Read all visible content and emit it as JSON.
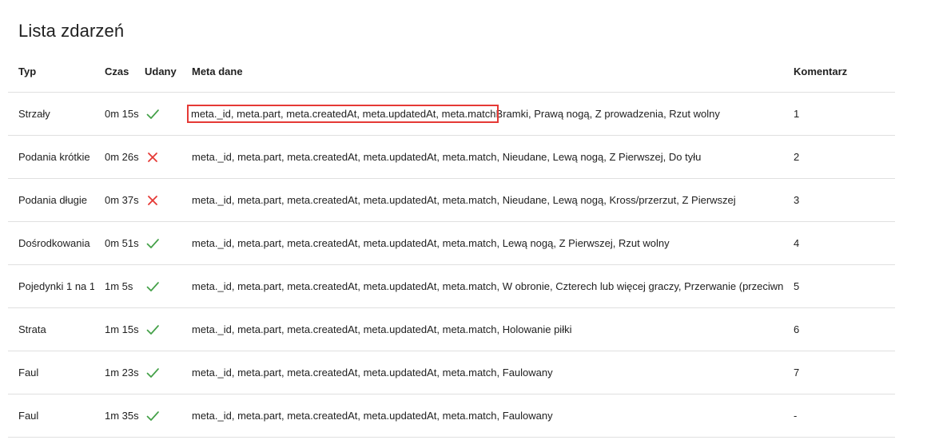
{
  "page": {
    "title": "Lista zdarzeń"
  },
  "table": {
    "headers": {
      "typ": "Typ",
      "czas": "Czas",
      "udany": "Udany",
      "meta": "Meta dane",
      "komentarz": "Komentarz"
    },
    "meta_prefix": "meta._id, meta.part, meta.createdAt, meta.updatedAt, meta.match",
    "rows": [
      {
        "typ": "Strzały",
        "czas": "0m 15s",
        "udany": "check-icon",
        "meta_suffix": "Bramki, Prawą nogą, Z prowadzenia, Rzut wolny",
        "komentarz": "1"
      },
      {
        "typ": "Podania krótkie",
        "czas": "0m 26s",
        "udany": "cross-icon",
        "meta_suffix": ", Nieudane, Lewą nogą, Z Pierwszej, Do tyłu",
        "komentarz": "2"
      },
      {
        "typ": "Podania długie",
        "czas": "0m 37s",
        "udany": "cross-icon",
        "meta_suffix": ", Nieudane, Lewą nogą, Kross/przerzut, Z Pierwszej",
        "komentarz": "3"
      },
      {
        "typ": "Dośrodkowania",
        "czas": "0m 51s",
        "udany": "check-icon",
        "meta_suffix": ", Lewą nogą, Z Pierwszej, Rzut wolny",
        "komentarz": "4"
      },
      {
        "typ": "Pojedynki 1 na 1",
        "czas": "1m 5s",
        "udany": "check-icon",
        "meta_suffix": ", W obronie, Czterech lub więcej graczy, Przerwanie (przeciwnicy)",
        "komentarz": "5"
      },
      {
        "typ": "Strata",
        "czas": "1m 15s",
        "udany": "check-icon",
        "meta_suffix": ", Holowanie piłki",
        "komentarz": "6"
      },
      {
        "typ": "Faul",
        "czas": "1m 23s",
        "udany": "check-icon",
        "meta_suffix": ", Faulowany",
        "komentarz": "7"
      },
      {
        "typ": "Faul",
        "czas": "1m 35s",
        "udany": "check-icon",
        "meta_suffix": ", Faulowany",
        "komentarz": "-"
      }
    ]
  },
  "colors": {
    "success": "#43a047",
    "failure": "#e53935",
    "highlight_border": "#e53935",
    "divider": "#e0e0e0"
  }
}
